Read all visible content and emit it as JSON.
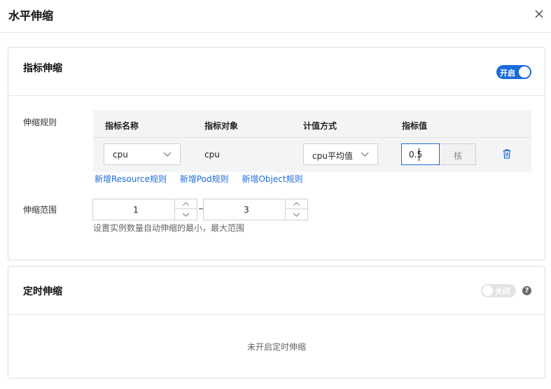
{
  "dialog": {
    "title": "水平伸缩"
  },
  "metric_scaling": {
    "title": "指标伸缩",
    "toggle_label": "开启",
    "rule_label": "伸缩规则",
    "columns": [
      "指标名称",
      "指标对象",
      "计值方式",
      "指标值"
    ],
    "row": {
      "metric_name": "cpu",
      "metric_object": "cpu",
      "calc_method": "cpu平均值",
      "metric_value": "0.5",
      "unit": "核"
    },
    "add_links": [
      "新增Resource规则",
      "新增Pod规则",
      "新增Object规则"
    ],
    "range_label": "伸缩范围",
    "range_min": "1",
    "range_max": "3",
    "range_hint": "设置实例数量自动伸缩的最小，最大范围"
  },
  "scheduled_scaling": {
    "title": "定时伸缩",
    "toggle_label": "关闭",
    "empty_text": "未开启定时伸缩"
  },
  "colors": {
    "accent": "#1a6bdc",
    "toggle_off": "#e3e3e3"
  }
}
